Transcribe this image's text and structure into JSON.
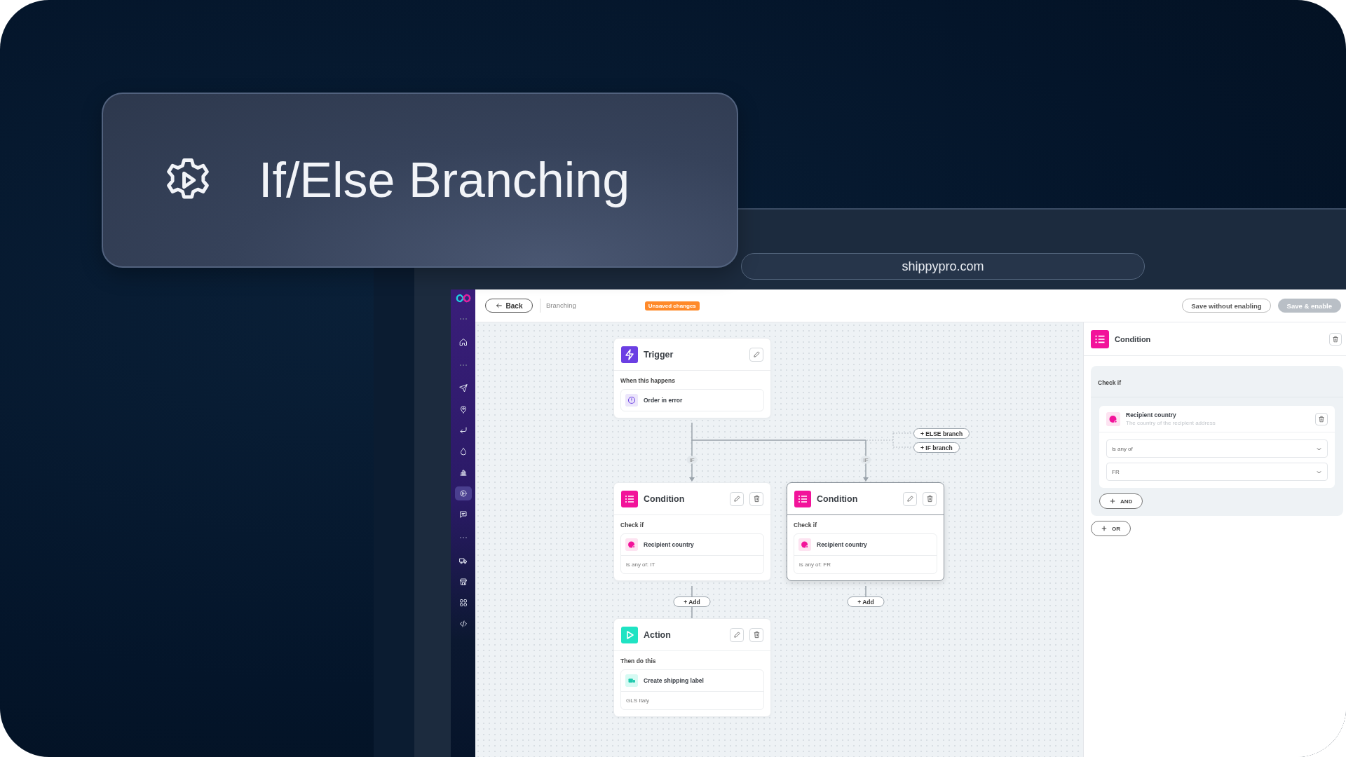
{
  "overlay_title": {
    "text": "If/Else Branching"
  },
  "browser": {
    "url": "shippypro.com"
  },
  "sidebar": {
    "groups": [
      {
        "items": [
          {
            "selected": false
          }
        ]
      },
      {
        "items": [
          {
            "selected": false
          },
          {
            "selected": false
          },
          {
            "selected": false
          },
          {
            "selected": false
          },
          {
            "selected": false
          },
          {
            "selected": true
          },
          {
            "selected": false
          }
        ]
      },
      {
        "items": [
          {
            "selected": false
          },
          {
            "selected": false
          },
          {
            "selected": false
          },
          {
            "selected": false
          }
        ]
      }
    ]
  },
  "toolbar": {
    "back": "Back",
    "breadcrumb": "Branching",
    "badge": "Unsaved changes",
    "buttons": [
      {
        "label": "Save without enabling",
        "disabled": false
      },
      {
        "label": "Save & enable",
        "disabled": true
      }
    ]
  },
  "canvas": {
    "nodes": [
      {
        "kind": "trigger",
        "title": "Trigger",
        "section": "When this happens",
        "item": "Order in error",
        "deletable": false,
        "selected": false
      },
      {
        "kind": "condition",
        "title": "Condition",
        "section": "Check if",
        "item": "Recipient country",
        "detail": "is any of: IT",
        "deletable": true,
        "selected": false
      },
      {
        "kind": "condition",
        "title": "Condition",
        "section": "Check if",
        "item": "Recipient country",
        "detail": "is any of: FR",
        "deletable": true,
        "selected": true
      },
      {
        "kind": "action",
        "title": "Action",
        "section": "Then do this",
        "item": "Create shipping label",
        "detail": "GLS Italy",
        "deletable": true,
        "selected": false
      }
    ],
    "branch_labels": [
      "IF",
      "IF"
    ],
    "branch_buttons": [
      "+ ELSE branch",
      "+ IF branch"
    ],
    "add_buttons": [
      "+ Add",
      "+ Add"
    ]
  },
  "panel": {
    "title": "Condition",
    "section": "Check if",
    "rule": {
      "title": "Recipient country",
      "description": "The country of the recipient address",
      "operator": "is any of",
      "value": "FR"
    },
    "and_button": "AND",
    "or_button": "OR"
  }
}
